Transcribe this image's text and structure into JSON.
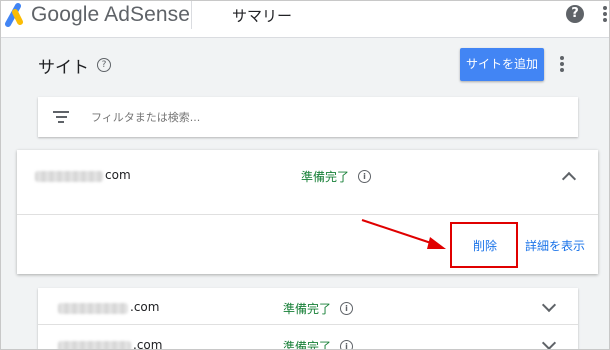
{
  "header": {
    "brand": "Google AdSense",
    "page_name": "サマリー",
    "help_icon_text": "?"
  },
  "sites_section": {
    "title": "サイト",
    "add_site_label": "サイトを追加"
  },
  "filter": {
    "placeholder": "フィルタまたは検索..."
  },
  "sites": [
    {
      "domain_suffix": "com",
      "status": "準備完了",
      "expanded": true,
      "actions": {
        "delete_label": "削除",
        "details_label": "詳細を表示"
      }
    },
    {
      "domain_suffix": ".com",
      "status": "準備完了",
      "expanded": false
    },
    {
      "domain_suffix": ".com",
      "status": "準備完了",
      "expanded": false
    }
  ],
  "colors": {
    "accent": "#4285f4",
    "status_ready": "#188038",
    "link": "#1a73e8",
    "annotation": "#e00000"
  },
  "icons": {
    "logo": "adsense-logo",
    "help": "help-circle-icon",
    "info": "info-icon",
    "filter": "filter-icon",
    "more": "more-vert-icon",
    "expand": "chevron-down-icon",
    "collapse": "chevron-up-icon"
  }
}
